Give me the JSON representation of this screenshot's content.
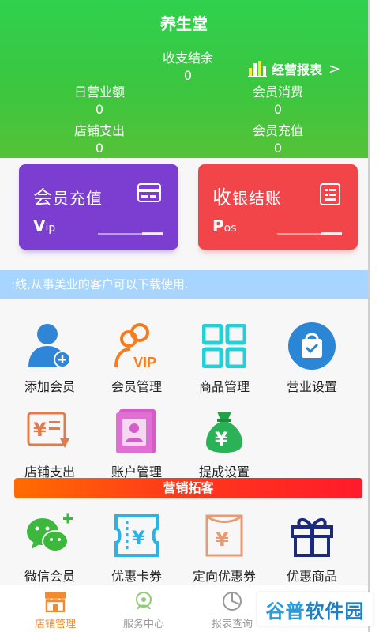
{
  "header": {
    "title": "养生堂",
    "balance": {
      "label": "收支结余",
      "value": "0"
    },
    "report_label": "经营报表",
    "report_chevron": ">",
    "daily_revenue": {
      "label": "日营业额",
      "value": "0"
    },
    "member_spend": {
      "label": "会员消费",
      "value": "0"
    },
    "store_expense": {
      "label": "店铺支出",
      "value": "0"
    },
    "member_recharge": {
      "label": "会员充值",
      "value": "0"
    }
  },
  "cards": {
    "recharge": {
      "title_first": "会",
      "title_rest": "员充值",
      "sub_big": "V",
      "sub_small": "ip"
    },
    "checkout": {
      "title_first": "收",
      "title_rest": "银结账",
      "sub_big": "P",
      "sub_small": "os"
    }
  },
  "notice": ":线,从事美业的客户可以下载使用.",
  "grid": {
    "add_member": "添加会员",
    "member_manage": "会员管理",
    "product_manage": "商品管理",
    "business_settings": "营业设置",
    "store_expense": "店铺支出",
    "account_manage": "账户管理",
    "commission_settings": "提成设置",
    "wechat_member": "微信会员",
    "coupons": "优惠卡券",
    "targeted_coupons": "定向优惠券",
    "promo_products": "优惠商品"
  },
  "banner": "营销拓客",
  "tabs": {
    "store": "店铺管理",
    "service": "服务中心",
    "reports": "报表查询"
  },
  "watermark": {
    "part1": "谷普",
    "part2": "软件园"
  },
  "colors": {
    "header_green": "#3cc640",
    "purple": "#7b3ed0",
    "red": "#f2454a",
    "notice_blue": "#a7d5ff",
    "active_tab": "#f28b30"
  }
}
